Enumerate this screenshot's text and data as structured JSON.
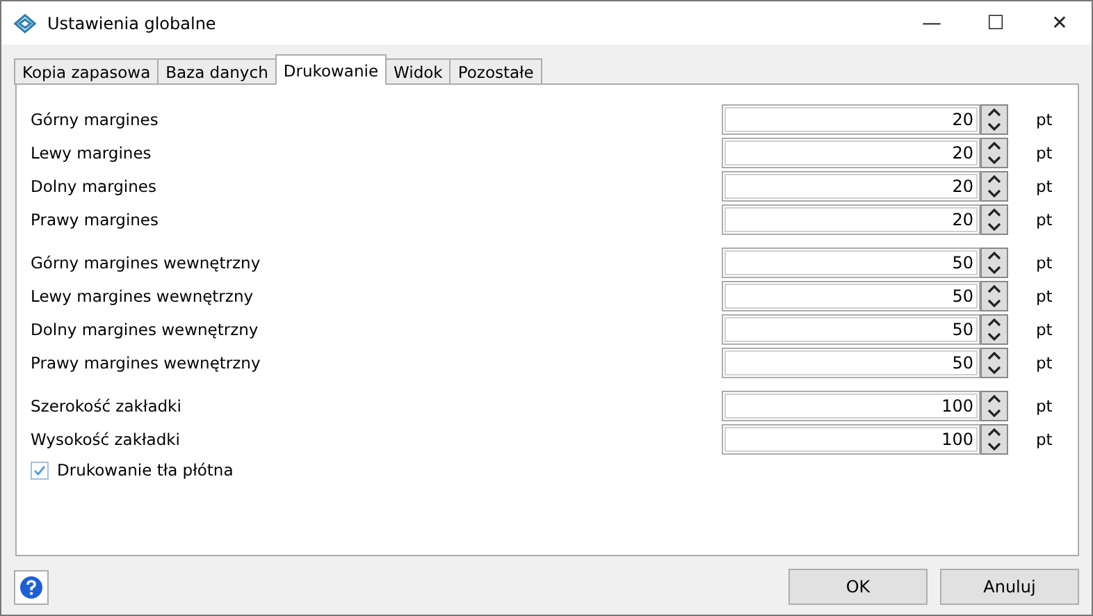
{
  "window": {
    "title": "Ustawienia globalne",
    "controls": [
      "—",
      "☐",
      "✕"
    ]
  },
  "tabs": [
    {
      "label": "Kopia zapasowa",
      "selected": false
    },
    {
      "label": "Baza danych",
      "selected": false
    },
    {
      "label": "Drukowanie",
      "selected": true
    },
    {
      "label": "Widok",
      "selected": false
    },
    {
      "label": "Pozostałe",
      "selected": false
    }
  ],
  "groups": [
    [
      {
        "label": "Górny margines",
        "value": "20",
        "unit": "pt"
      },
      {
        "label": "Lewy margines",
        "value": "20",
        "unit": "pt"
      },
      {
        "label": "Dolny margines",
        "value": "20",
        "unit": "pt"
      },
      {
        "label": "Prawy margines",
        "value": "20",
        "unit": "pt"
      }
    ],
    [
      {
        "label": "Górny margines wewnętrzny",
        "value": "50",
        "unit": "pt"
      },
      {
        "label": "Lewy margines wewnętrzny",
        "value": "50",
        "unit": "pt"
      },
      {
        "label": "Dolny margines wewnętrzny",
        "value": "50",
        "unit": "pt"
      },
      {
        "label": "Prawy margines wewnętrzny",
        "value": "50",
        "unit": "pt"
      }
    ],
    [
      {
        "label": "Szerokość zakładki",
        "value": "100",
        "unit": "pt"
      },
      {
        "label": "Wysokość zakładki",
        "value": "100",
        "unit": "pt"
      }
    ]
  ],
  "checkbox": {
    "label": "Drukowanie tła płótna",
    "checked": true
  },
  "buttons": [
    "OK",
    "Anuluj"
  ]
}
